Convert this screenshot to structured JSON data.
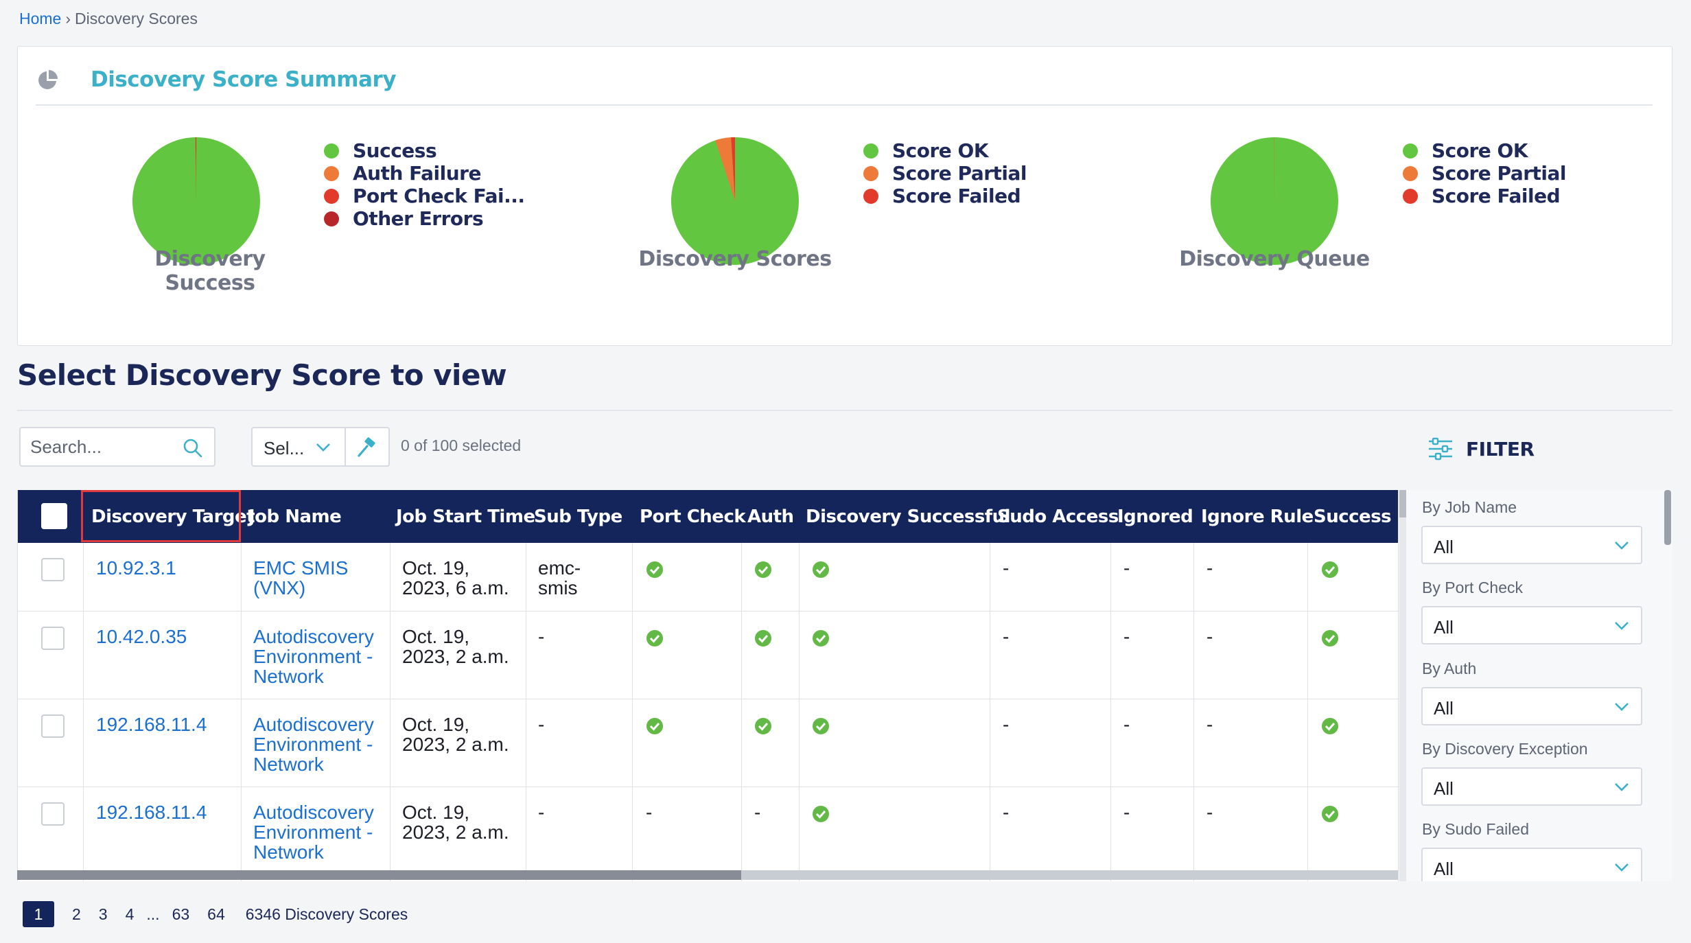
{
  "breadcrumb": {
    "home": "Home",
    "separator": "›",
    "current": "Discovery Scores"
  },
  "summary": {
    "title": "Discovery Score Summary",
    "icon": "pie-chart-icon",
    "charts": [
      {
        "label": "Discovery Success",
        "legend": [
          "Success",
          "Auth Failure",
          "Port Check Fai...",
          "Other Errors"
        ],
        "colors": [
          "#62c641",
          "#ee7a3a",
          "#e33b2b",
          "#b8262a"
        ],
        "values": [
          99.7,
          0.1,
          0.1,
          0.1
        ]
      },
      {
        "label": "Discovery Scores",
        "legend": [
          "Score OK",
          "Score Partial",
          "Score Failed"
        ],
        "colors": [
          "#62c641",
          "#ee7a3a",
          "#e33b2b"
        ],
        "values": [
          95.0,
          4.0,
          1.0
        ]
      },
      {
        "label": "Discovery Queue",
        "legend": [
          "Score OK",
          "Score Partial",
          "Score Failed"
        ],
        "colors": [
          "#62c641",
          "#ee7a3a",
          "#e33b2b"
        ],
        "values": [
          99.9,
          0.05,
          0.05
        ]
      }
    ]
  },
  "section_title": "Select Discovery Score to view",
  "toolbar": {
    "search_placeholder": "Search...",
    "select_label": "Sel...",
    "selected_count": "0 of 100 selected",
    "filter_label": "FILTER"
  },
  "table": {
    "columns": [
      "Discovery Target",
      "Job Name",
      "Job Start Time",
      "Sub Type",
      "Port Check",
      "Auth",
      "Discovery Successful",
      "Sudo Access",
      "Ignored",
      "Ignore Rule",
      "Success"
    ],
    "rows": [
      {
        "target": "10.92.3.1",
        "job_name": [
          "EMC SMIS",
          "(VNX)"
        ],
        "start_time": [
          "Oct. 19,",
          "2023, 6 a.m."
        ],
        "sub_type": [
          "emc-",
          "smis"
        ],
        "port_check": "check",
        "auth": "check",
        "discovery_successful": "check",
        "sudo_access": "-",
        "ignored": "-",
        "ignore_rule": "-",
        "success": "check"
      },
      {
        "target": "10.42.0.35",
        "job_name": [
          "Autodiscovery",
          "Environment -",
          "Network"
        ],
        "start_time": [
          "Oct. 19,",
          "2023, 2 a.m."
        ],
        "sub_type": [
          "-"
        ],
        "port_check": "check",
        "auth": "check",
        "discovery_successful": "check",
        "sudo_access": "-",
        "ignored": "-",
        "ignore_rule": "-",
        "success": "check"
      },
      {
        "target": "192.168.11.4",
        "job_name": [
          "Autodiscovery",
          "Environment -",
          "Network"
        ],
        "start_time": [
          "Oct. 19,",
          "2023, 2 a.m."
        ],
        "sub_type": [
          "-"
        ],
        "port_check": "check",
        "auth": "check",
        "discovery_successful": "check",
        "sudo_access": "-",
        "ignored": "-",
        "ignore_rule": "-",
        "success": "check"
      },
      {
        "target": "192.168.11.4",
        "job_name": [
          "Autodiscovery",
          "Environment -",
          "Network"
        ],
        "start_time": [
          "Oct. 19,",
          "2023, 2 a.m."
        ],
        "sub_type": [
          "-"
        ],
        "port_check": "-",
        "auth": "-",
        "discovery_successful": "check",
        "sudo_access": "-",
        "ignored": "-",
        "ignore_rule": "-",
        "success": "check"
      }
    ]
  },
  "filters": [
    {
      "label": "By Job Name",
      "value": "All"
    },
    {
      "label": "By Port Check",
      "value": "All"
    },
    {
      "label": "By Auth",
      "value": "All"
    },
    {
      "label": "By Discovery Exception",
      "value": "All"
    },
    {
      "label": "By Sudo Failed",
      "value": "All"
    }
  ],
  "pagination": {
    "pages": [
      "1",
      "2",
      "3",
      "4",
      "...",
      "63",
      "64"
    ],
    "active": "1",
    "total": "6346 Discovery Scores"
  },
  "colors": {
    "navy": "#13255a",
    "teal": "#3bb0c9",
    "link": "#1a6fd1",
    "success_green": "#62c641",
    "highlight_red": "#e0393e"
  }
}
